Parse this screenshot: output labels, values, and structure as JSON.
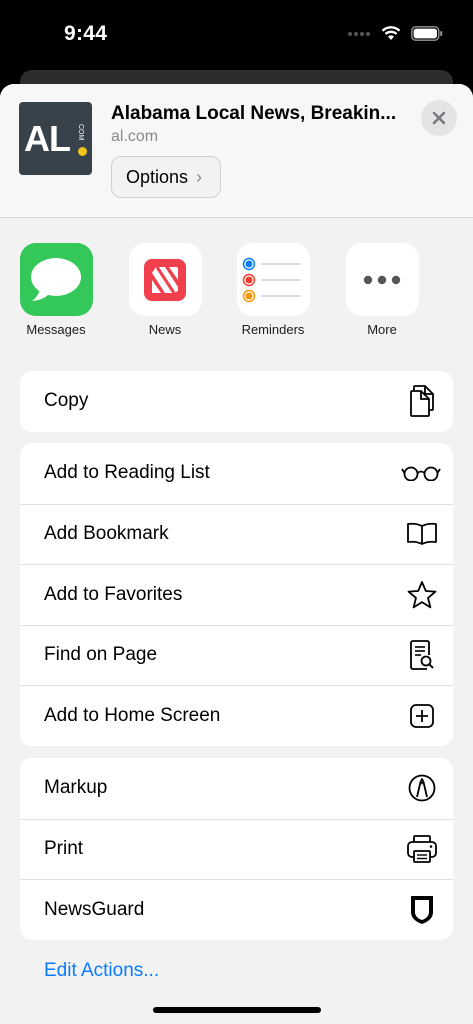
{
  "status_bar": {
    "time": "9:44"
  },
  "share_sheet": {
    "site": {
      "title": "Alabama Local News, Breakin...",
      "domain": "al.com",
      "logo_text": "AL",
      "logo_small_text": "COM",
      "options_label": "Options",
      "options_chevron": "›"
    },
    "apps": [
      {
        "label": "Messages",
        "icon": "messages-icon"
      },
      {
        "label": "News",
        "icon": "news-icon"
      },
      {
        "label": "Reminders",
        "icon": "reminders-icon"
      },
      {
        "label": "More",
        "icon": "more-icon"
      }
    ],
    "groups": [
      [
        {
          "label": "Copy",
          "icon": "copy-icon"
        }
      ],
      [
        {
          "label": "Add to Reading List",
          "icon": "glasses-icon"
        },
        {
          "label": "Add Bookmark",
          "icon": "book-icon"
        },
        {
          "label": "Add to Favorites",
          "icon": "star-icon"
        },
        {
          "label": "Find on Page",
          "icon": "find-document-icon"
        },
        {
          "label": "Add to Home Screen",
          "icon": "plus-square-icon"
        }
      ],
      [
        {
          "label": "Markup",
          "icon": "markup-pen-icon"
        },
        {
          "label": "Print",
          "icon": "printer-icon"
        },
        {
          "label": "NewsGuard",
          "icon": "shield-icon"
        }
      ]
    ],
    "edit_actions": "Edit Actions..."
  },
  "colors": {
    "accent": "#0a7aff",
    "messages_green": "#34c759",
    "news_red": "#f0404e",
    "reminder_blue": "#0a7aff",
    "reminder_red": "#ff3b30",
    "reminder_orange": "#ff9500"
  }
}
